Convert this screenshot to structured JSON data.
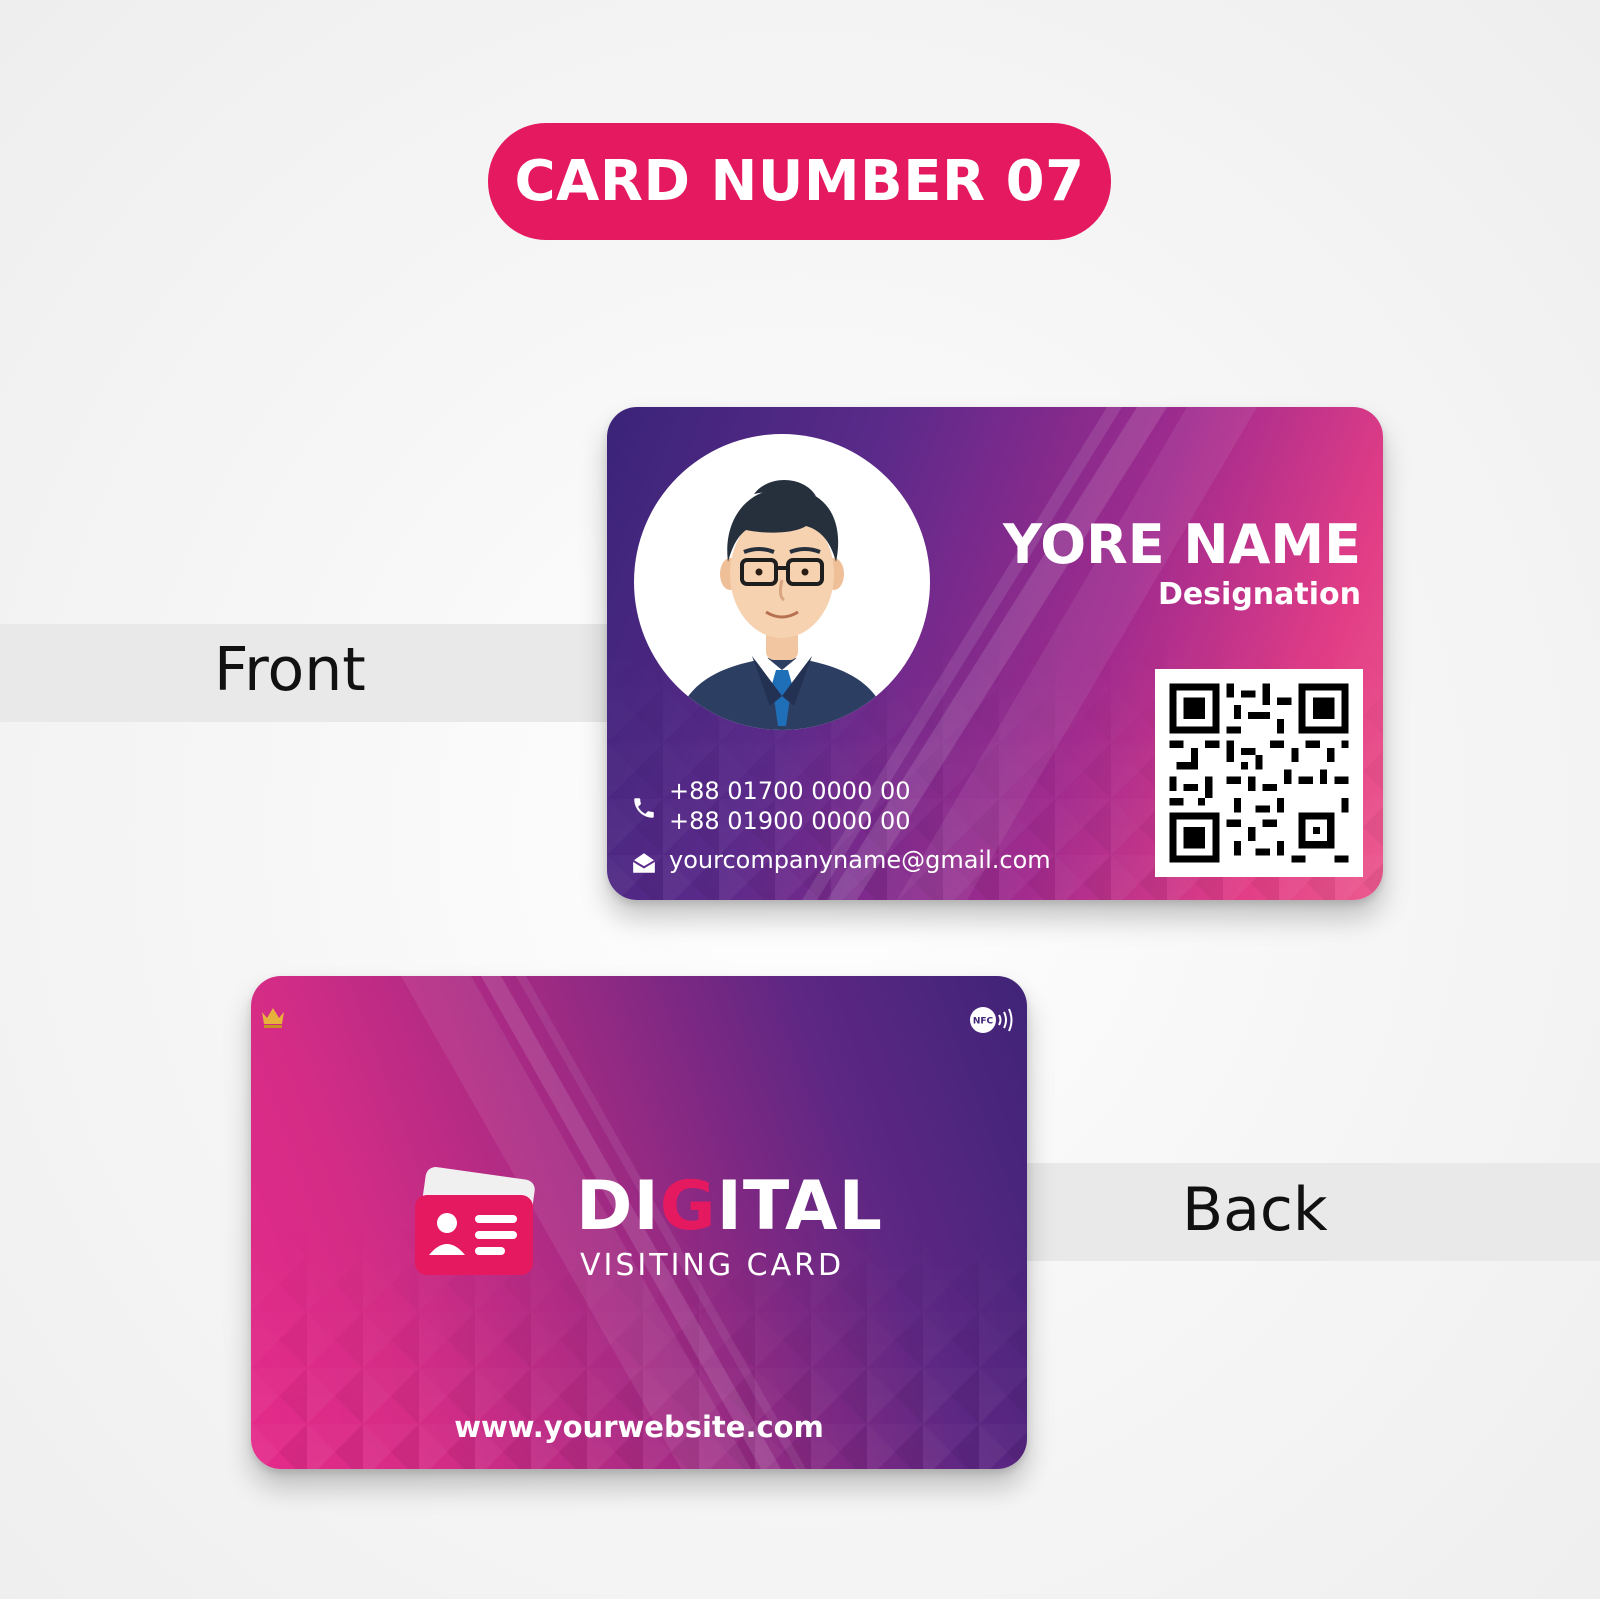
{
  "title": "CARD NUMBER 07",
  "labels": {
    "front": "Front",
    "back": "Back"
  },
  "front_card": {
    "name": "YORE NAME",
    "designation": "Designation",
    "phone_1": "+88 01700 0000 00",
    "phone_2": "+88 01900 0000 00",
    "email": "yourcompanyname@gmail.com",
    "icons": [
      "phone-icon",
      "mail-icon",
      "qr-code",
      "avatar"
    ]
  },
  "back_card": {
    "logo_word_prefix": "DI",
    "logo_word_accent": "G",
    "logo_word_suffix": "ITAL",
    "logo_subtitle": "VISITING CARD",
    "website": "www.yourwebsite.com",
    "icons": [
      "crown-icon",
      "nfc-icon",
      "id-card-logo"
    ]
  },
  "colors": {
    "accent": "#e5195f",
    "card_purple": "#3a2478",
    "card_pink": "#e23d86",
    "background": "#f3f3f3"
  }
}
